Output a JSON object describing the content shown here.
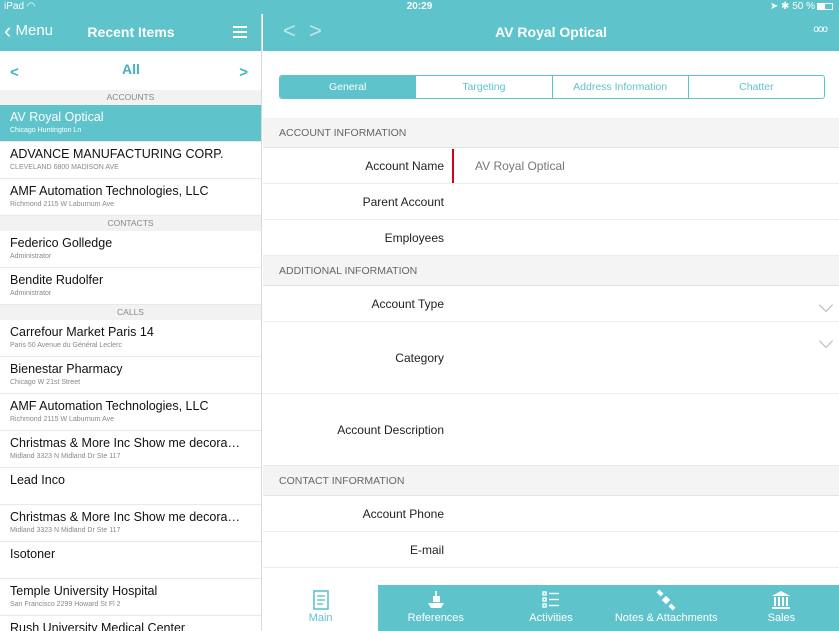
{
  "status": {
    "left": "iPad",
    "time": "20:29",
    "battery": "50 %"
  },
  "left": {
    "menu_label": "Menu",
    "title": "Recent Items",
    "filter": {
      "prev": "<",
      "current": "All",
      "next": ">"
    },
    "sections": [
      {
        "header": "ACCOUNTS",
        "items": [
          {
            "title": "AV Royal Optical",
            "subtitle": "Chicago Huntington Ln",
            "selected": true
          },
          {
            "title": "ADVANCE MANUFACTURING CORP.",
            "subtitle": "CLEVELAND 6800 MADISON AVE"
          },
          {
            "title": "AMF Automation Technologies, LLC",
            "subtitle": "Richmond 2115 W Laburnum Ave"
          }
        ]
      },
      {
        "header": "CONTACTS",
        "items": [
          {
            "title": "Federico Golledge",
            "subtitle": "Administrator"
          },
          {
            "title": "Bendite Rudolfer",
            "subtitle": "Administrator"
          }
        ]
      },
      {
        "header": "CALLS",
        "items": [
          {
            "title": "Carrefour Market Paris 14",
            "subtitle": "Paris 50 Avenue du Général Leclerc"
          },
          {
            "title": "Bienestar Pharmacy",
            "subtitle": "Chicago W 21st Street"
          },
          {
            "title": "AMF Automation Technologies, LLC",
            "subtitle": "Richmond 2115 W Laburnum Ave"
          },
          {
            "title": "Christmas & More Inc Show me decora…",
            "subtitle": "Midland 3323 N Midland Dr Ste 117"
          },
          {
            "title": "Lead Inco",
            "subtitle": ""
          },
          {
            "title": "Christmas & More Inc Show me decora…",
            "subtitle": "Midland 3323 N Midland Dr Ste 117"
          },
          {
            "title": "Isotoner",
            "subtitle": ""
          },
          {
            "title": "Temple University Hospital",
            "subtitle": "San Francisco 2299 Howard St Fl 2"
          },
          {
            "title": "Rush University Medical Center",
            "subtitle": ""
          }
        ]
      }
    ]
  },
  "right": {
    "title": "AV Royal Optical",
    "back": "<",
    "forward": ">",
    "more": "ooo",
    "tabs": [
      {
        "label": "General",
        "active": true
      },
      {
        "label": "Targeting"
      },
      {
        "label": "Address Information"
      },
      {
        "label": "Chatter"
      }
    ],
    "sections": [
      {
        "header": "ACCOUNT INFORMATION",
        "fields": [
          {
            "label": "Account Name",
            "value": "AV Royal Optical",
            "required": true
          },
          {
            "label": "Parent Account",
            "value": ""
          },
          {
            "label": "Employees",
            "value": ""
          }
        ]
      },
      {
        "header": "ADDITIONAL INFORMATION",
        "fields": [
          {
            "label": "Account Type",
            "value": "",
            "picklist": true
          },
          {
            "label": "Category",
            "value": "",
            "picklist": true,
            "tall": true
          },
          {
            "label": "Account Description",
            "value": "",
            "tall": true
          }
        ]
      },
      {
        "header": "CONTACT INFORMATION",
        "fields": [
          {
            "label": "Account Phone",
            "value": ""
          },
          {
            "label": "E-mail",
            "value": ""
          }
        ]
      }
    ]
  },
  "tabbar": [
    {
      "label": "Main",
      "icon": "book-icon",
      "active": true
    },
    {
      "label": "References",
      "icon": "ship-icon"
    },
    {
      "label": "Activities",
      "icon": "checklist-icon"
    },
    {
      "label": "Notes & Attachments",
      "icon": "satellite-icon"
    },
    {
      "label": "Sales",
      "icon": "bank-icon"
    }
  ]
}
